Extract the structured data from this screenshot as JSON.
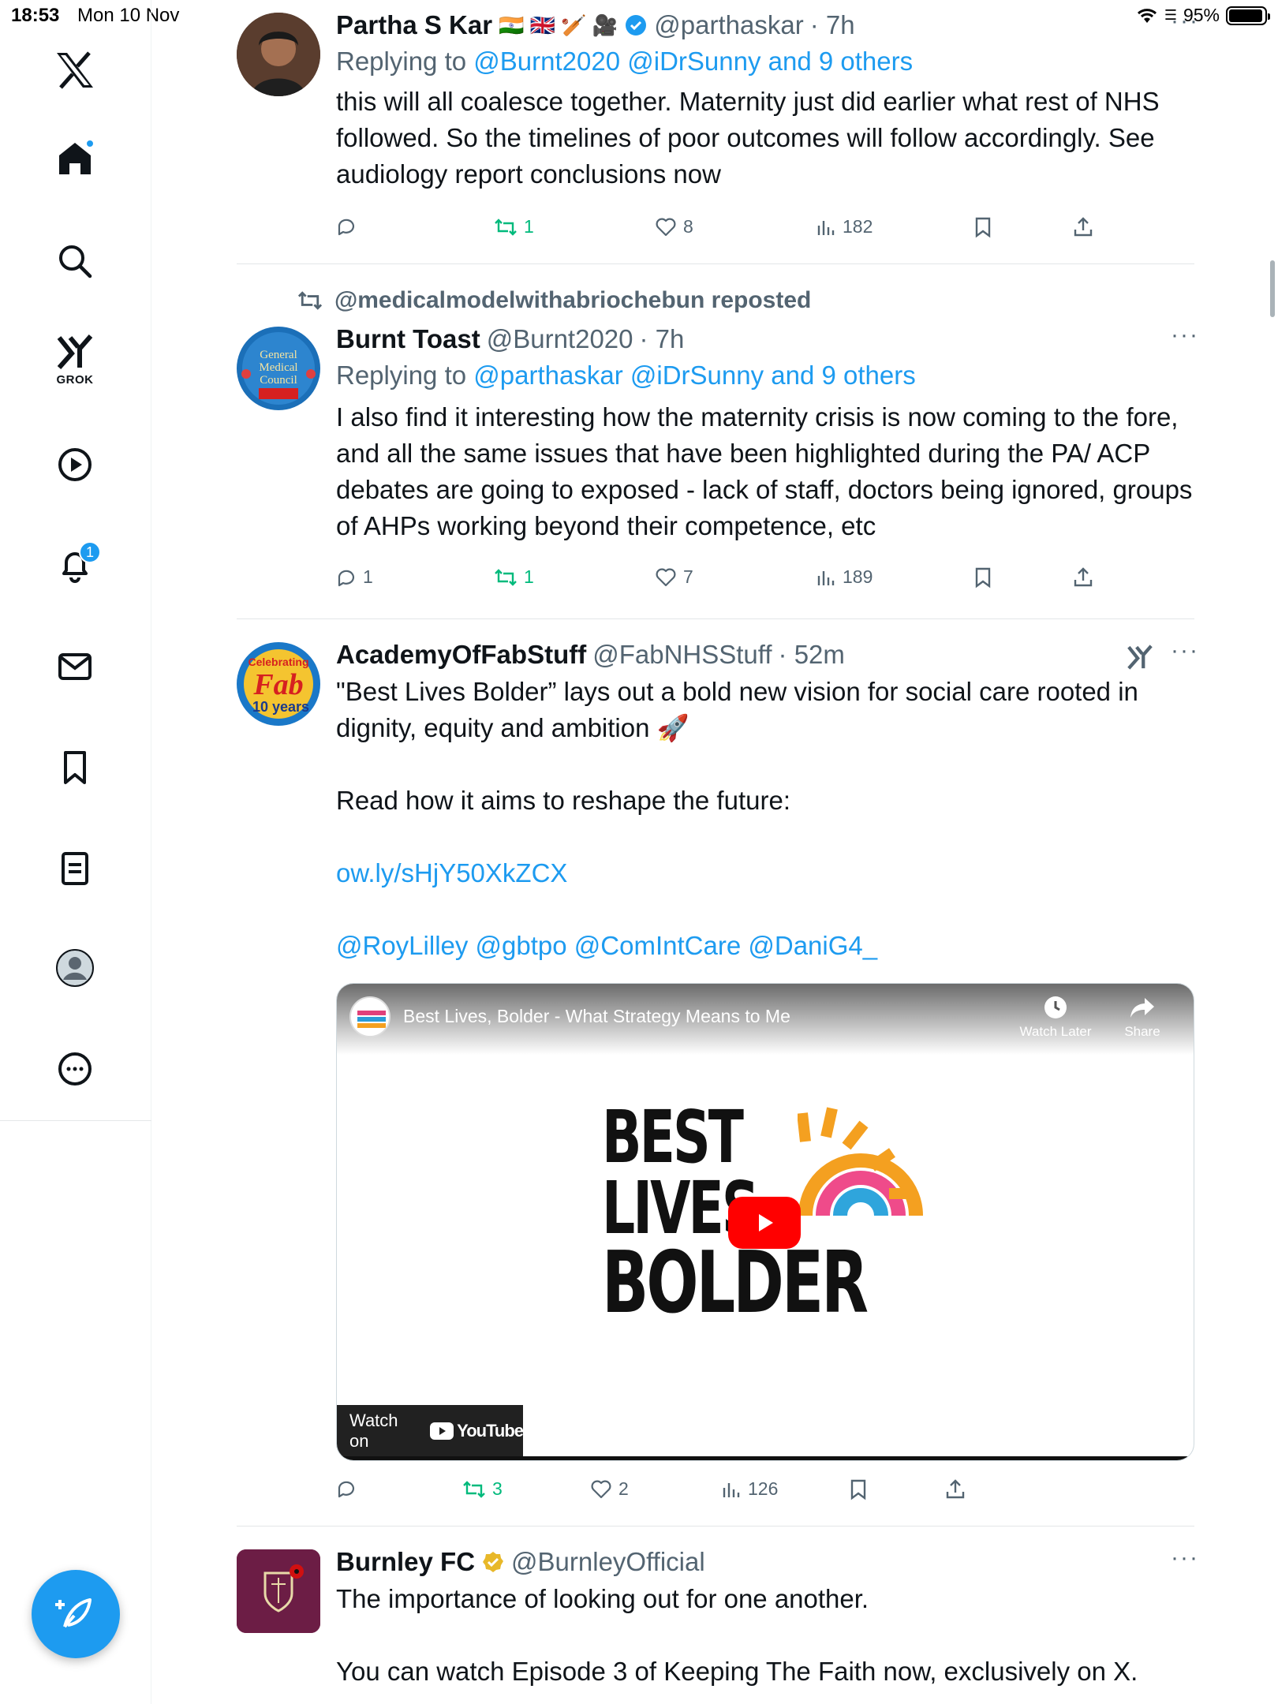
{
  "status": {
    "time": "18:53",
    "date": "Mon 10 Nov",
    "battery": "95%"
  },
  "sidebar": {
    "grok_label": "GROK",
    "notifications_count": "1"
  },
  "tweets": [
    {
      "name": "Partha S Kar",
      "emojis": "🇮🇳 🇬🇧 🏏 🎥",
      "handle": "@parthaskar",
      "time": "· 7h",
      "reply_prefix": "Replying to",
      "reply_mentions": "@Burnt2020 @iDrSunny and 9 others",
      "text": "this will all coalesce together. Maternity just did earlier what rest of NHS followed. So the timelines of poor outcomes will follow accordingly. See audiology report conclusions now",
      "replies": "",
      "reposts": "1",
      "likes": "8",
      "views": "182"
    },
    {
      "repost_by": "@medicalmodelwithabriochebun reposted",
      "name": "Burnt Toast",
      "handle": "@Burnt2020",
      "time": "· 7h",
      "reply_prefix": "Replying to",
      "reply_mentions": "@parthaskar @iDrSunny and 9 others",
      "text": "I also find it interesting how the maternity crisis is now coming to the fore, and all the same issues that have been highlighted during the PA/ ACP debates are going to exposed - lack of staff, doctors being ignored, groups of AHPs working beyond their competence, etc",
      "replies": "1",
      "reposts": "1",
      "likes": "7",
      "views": "189"
    },
    {
      "name": "AcademyOfFabStuff",
      "handle": "@FabNHSStuff",
      "time": "· 52m",
      "text_1": "\"Best Lives Bolder” lays out a bold new vision for social care rooted in dignity, equity and ambition 🚀",
      "text_2": "Read how it aims to reshape the future:",
      "link": "ow.ly/sHjY50XkZCX",
      "mentions": "@RoyLilley @gbtpo @ComIntCare @DaniG4_",
      "video": {
        "title": "Best Lives, Bolder - What Strategy Means to Me",
        "watch_later": "Watch Later",
        "share": "Share",
        "watch_on": "Watch on",
        "youtube": "YouTube",
        "graphic_line1": "BEST",
        "graphic_line2": "LIVES",
        "graphic_line3": "BOLDER"
      },
      "replies": "",
      "reposts": "3",
      "likes": "2",
      "views": "126"
    },
    {
      "name": "Burnley FC",
      "handle": "@BurnleyOfficial",
      "text_1": "The importance of looking out for one another.",
      "text_2": "You can watch Episode 3 of Keeping The Faith now, exclusively on X."
    }
  ],
  "colors": {
    "accent": "#1d9bf0",
    "repost_green": "#00ba7c",
    "muted": "#536471",
    "verified_gold": "#e8b829"
  }
}
